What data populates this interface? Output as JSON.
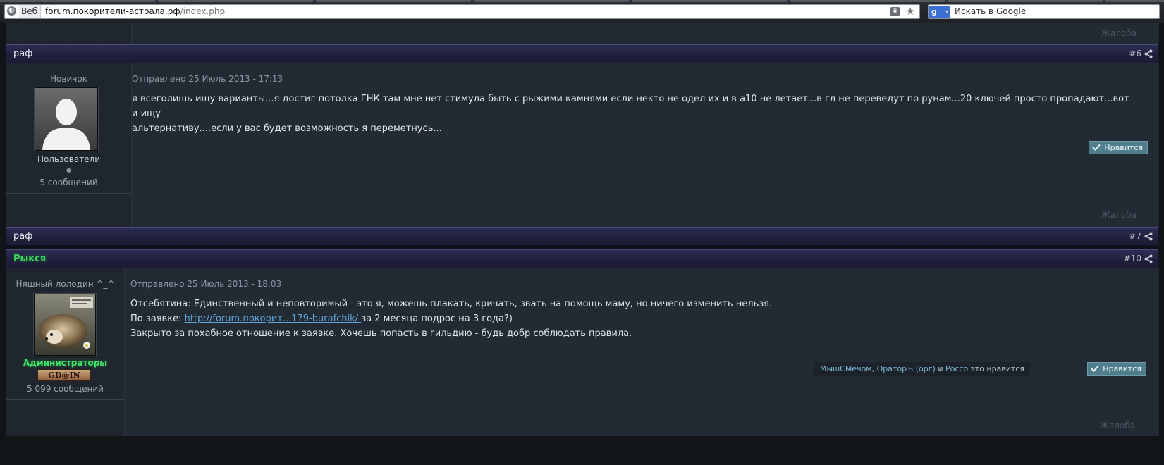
{
  "browser": {
    "protocol_label": "Веб",
    "url_host": "forum.покорители-астрала.рф",
    "url_path": "/index.php",
    "search_placeholder": "Искать в Google",
    "search_engine_icon": "google-g-icon"
  },
  "top_report": "Жалоба",
  "posts": [
    {
      "author": "раф",
      "number": "#6",
      "rank": "Новичок",
      "group": "Пользователи",
      "post_count": "5 сообщений",
      "date": "Отправлено 25 Июль 2013 - 17:13",
      "body_line1": "я всеголишь ищу варианты...я достиг потолка ГНК там мне нет стимула быть с рыжими камнями если некто не одел их и в а10 не летает...в гл не переведут по рунам...20 ключей просто пропадают...вот и ищу",
      "body_line2": "альтернативу....если у вас будет возможность я переметнусь...",
      "like_label": "Нравится",
      "report": "Жалоба"
    },
    {
      "author": "раф",
      "number": "#7"
    },
    {
      "author": "Рыкся",
      "number": "#10",
      "rank": "Няшный лолодин ^_^",
      "group": "Администраторы",
      "badge": "GD@IN",
      "post_count": "5 099 сообщений",
      "date": "Отправлено 25 Июль 2013 - 18:03",
      "body_line1": "Отсебятина: Единственный и неповторимый - это я, можешь плакать, кричать, звать на помощь маму, но ничего изменить нельзя.",
      "body_line2_prefix": "По заявке: ",
      "body_line2_link": "http://forum.покорит...179-burafchik/ ",
      "body_line2_suffix": " за 2 месяца подрос на 3 года?)",
      "body_line3": "Закрыто за похабное отношение к заявке. Хочешь попасть в гильдию - будь добр соблюдать правила.",
      "likers": {
        "user1": "МышСМечом",
        "sep1": ", ",
        "user2": "ОраторЪ (орг)",
        "and": " и ",
        "user3": "Россо",
        "suffix": " это нравится"
      },
      "like_label": "Нравится",
      "report": "Жалоба"
    }
  ],
  "colors": {
    "admin_green": "#40e06a",
    "link_blue": "#5fa6d8",
    "like_button": "#4f7f8c",
    "post_bar": "#1f1f3c"
  }
}
